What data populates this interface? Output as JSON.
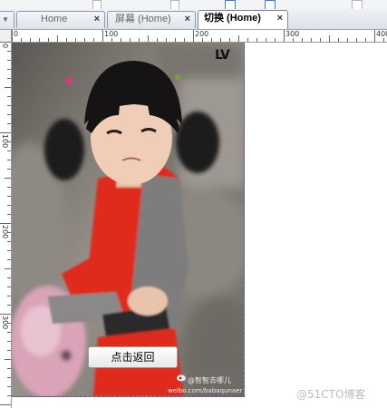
{
  "tabs": [
    {
      "label": "Home",
      "active": false
    },
    {
      "label": "屏幕 (Home)",
      "active": false
    },
    {
      "label": "切换 (Home)",
      "active": true
    }
  ],
  "close_glyph": "×",
  "dropdown_glyph": "▼",
  "ruler": {
    "horizontal_labels": [
      "0",
      "100",
      "200",
      "300",
      "400"
    ],
    "vertical_labels": [
      "0",
      "100",
      "200",
      "300"
    ]
  },
  "canvas": {
    "logo_text": "LV",
    "button_label": "点击返回",
    "watermark_line1": "@智智去哪儿",
    "watermark_line2": "weibo.com/babaqunaer"
  },
  "page_watermark": "@51CTO博客",
  "colors": {
    "active_tab_bg": "#ffffff",
    "shirt_red": "#e02a1a",
    "ruler_line": "#666666"
  },
  "icons": {
    "tab_close": "close-icon",
    "tab_menu": "dropdown-arrow-icon",
    "weibo": "weibo-logo-icon"
  }
}
